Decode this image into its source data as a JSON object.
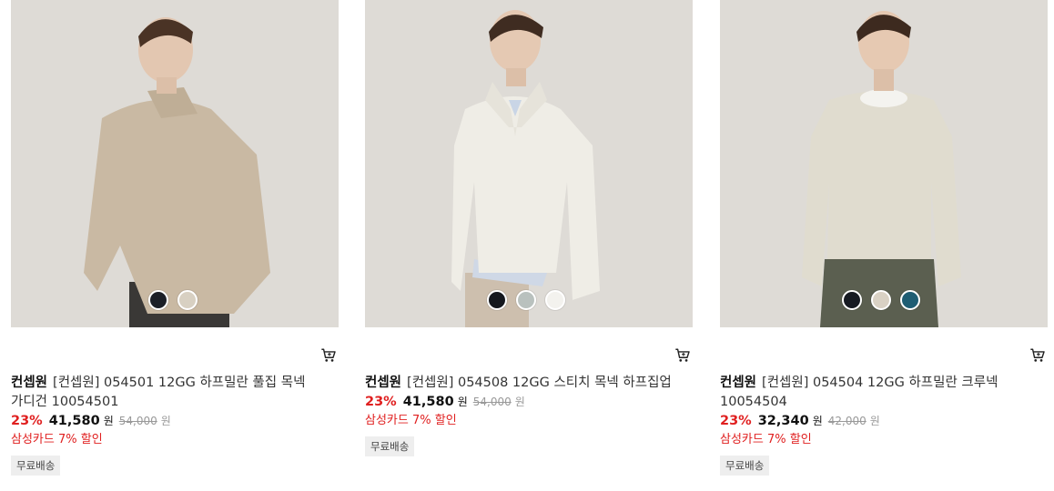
{
  "products": [
    {
      "brand": "컨셉원",
      "name": "[컨셉원] 054501 12GG 하프밀란 풀집 목넥 가디건 10054501",
      "discount_rate": "23%",
      "price": "41,580",
      "currency": "원",
      "original_price": "54,000",
      "original_currency": "원",
      "card_discount": "삼성카드 7% 할인",
      "shipping_badge": "무료배송",
      "sweater_color": "#c9b9a3",
      "swatches": [
        "#1b1f27",
        "#d8d0c2"
      ]
    },
    {
      "brand": "컨셉원",
      "name": "[컨셉원] 054508 12GG 스티치 목넥 하프집업",
      "discount_rate": "23%",
      "price": "41,580",
      "currency": "원",
      "original_price": "54,000",
      "original_currency": "원",
      "card_discount": "삼성카드 7% 할인",
      "shipping_badge": "무료배송",
      "sweater_color": "#efede6",
      "swatches": [
        "#15181e",
        "#b9c1be",
        "#f3f2ee"
      ]
    },
    {
      "brand": "컨셉원",
      "name": "[컨셉원] 054504 12GG 하프밀란 크루넥 10054504",
      "discount_rate": "23%",
      "price": "32,340",
      "currency": "원",
      "original_price": "42,000",
      "original_currency": "원",
      "card_discount": "삼성카드 7% 할인",
      "shipping_badge": "무료배송",
      "sweater_color": "#e0dccf",
      "swatches": [
        "#161a22",
        "#d9d1c4",
        "#1f5d73"
      ]
    }
  ],
  "icons": {
    "cart": "cart-icon"
  }
}
